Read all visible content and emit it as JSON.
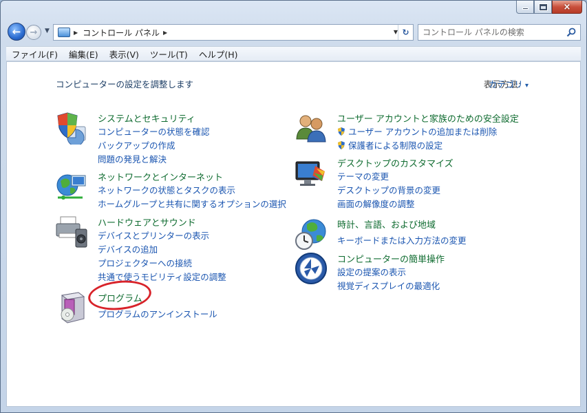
{
  "window": {
    "caption": {
      "minimize": "minimize",
      "maximize": "maximize",
      "close": "×"
    }
  },
  "nav": {
    "back_glyph": "←",
    "forward_glyph": "→",
    "history_glyph": "▼",
    "address_sep": "▶",
    "address_path": "コントロール パネル",
    "address_trail_sep": "▶",
    "address_drop": "▼",
    "refresh_glyph": "↻",
    "search_placeholder": "コントロール パネルの検索"
  },
  "menubar": {
    "file": "ファイル(F)",
    "edit": "編集(E)",
    "view": "表示(V)",
    "tools": "ツール(T)",
    "help": "ヘルプ(H)"
  },
  "content": {
    "heading": "コンピューターの設定を調整します",
    "view_by_label": "表示方法:",
    "view_by_value": "カテゴリ"
  },
  "left_categories": [
    {
      "title": "システムとセキュリティ",
      "links": [
        "コンピューターの状態を確認",
        "バックアップの作成",
        "問題の発見と解決"
      ]
    },
    {
      "title": "ネットワークとインターネット",
      "links": [
        "ネットワークの状態とタスクの表示",
        "ホームグループと共有に関するオプションの選択"
      ]
    },
    {
      "title": "ハードウェアとサウンド",
      "links": [
        "デバイスとプリンターの表示",
        "デバイスの追加",
        "プロジェクターへの接続",
        "共通で使うモビリティ設定の調整"
      ]
    },
    {
      "title": "プログラム",
      "links": [
        "プログラムのアンインストール"
      ]
    }
  ],
  "right_categories": [
    {
      "title": "ユーザー アカウントと家族のための安全設定",
      "links": [
        "ユーザー アカウントの追加または削除",
        "保護者による制限の設定"
      ]
    },
    {
      "title": "デスクトップのカスタマイズ",
      "links": [
        "テーマの変更",
        "デスクトップの背景の変更",
        "画面の解像度の調整"
      ]
    },
    {
      "title": "時計、言語、および地域",
      "links": [
        "キーボードまたは入力方法の変更"
      ]
    },
    {
      "title": "コンピューターの簡単操作",
      "links": [
        "設定の提案の表示",
        "視覚ディスプレイの最適化"
      ]
    }
  ],
  "colors": {
    "category_title": "#0e6b2f",
    "link": "#1a55b0",
    "highlight_ring": "#d8232a"
  },
  "icons": {
    "system_security": "shield-pie-icon",
    "network": "globe-network-icon",
    "hardware_sound": "printer-speaker-icon",
    "programs": "program-box-icon",
    "user_accounts": "users-icon",
    "appearance": "monitor-palette-icon",
    "clock_region": "globe-clock-icon",
    "ease_of_access": "ease-of-access-icon"
  }
}
